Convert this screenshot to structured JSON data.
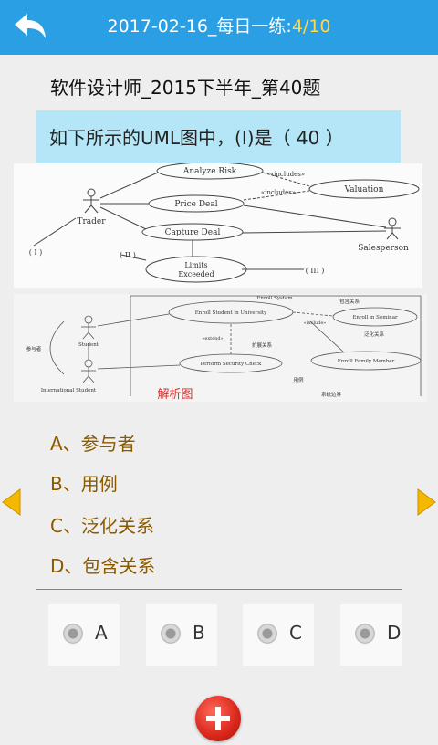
{
  "header": {
    "title_prefix": "2017-02-16_每日一练:",
    "progress": "4/10",
    "colors": {
      "bar": "#2a9fe3",
      "progress": "#ffd84a"
    }
  },
  "subject": "软件设计师_2015下半年_第40题",
  "question": "如下所示的UML图中，(I)是（ 40 ）",
  "uml_figure": {
    "use_cases": [
      "Analyze Risk",
      "Price Deal",
      "Capture Deal",
      "Limits",
      "Exceeded",
      "Valuation"
    ],
    "actors": [
      "Trader",
      "Salesperson"
    ],
    "relations": [
      "«includes»",
      "«includes»"
    ],
    "markers": [
      "( I )",
      "( II )",
      "( III )"
    ]
  },
  "analysis_figure": {
    "label": "解析图",
    "system": "Enroll System",
    "use_cases": [
      "Enroll Student in University",
      "Enroll in Seminar",
      "Perform Security Check",
      "Enroll Family Member"
    ],
    "actors": [
      "Student",
      "International Student"
    ],
    "relations": [
      "«include»",
      "«extend»"
    ],
    "notes": [
      "参与者",
      "包含关系",
      "泛化关系",
      "扩展关系",
      "用例",
      "系统边界"
    ]
  },
  "options": [
    {
      "letter": "A",
      "text": "A、参与者"
    },
    {
      "letter": "B",
      "text": "B、用例"
    },
    {
      "letter": "C",
      "text": "C、泛化关系"
    },
    {
      "letter": "D",
      "text": "D、包含关系"
    }
  ],
  "answers": [
    "A",
    "B",
    "C",
    "D"
  ],
  "icons": {
    "back": "back-arrow-icon",
    "prev": "left-triangle-icon",
    "next": "right-triangle-icon",
    "add": "plus-icon"
  },
  "accent_colors": {
    "option_text": "#8a5a00",
    "arrows": "#f5b800",
    "add_button": "#d9261b"
  }
}
